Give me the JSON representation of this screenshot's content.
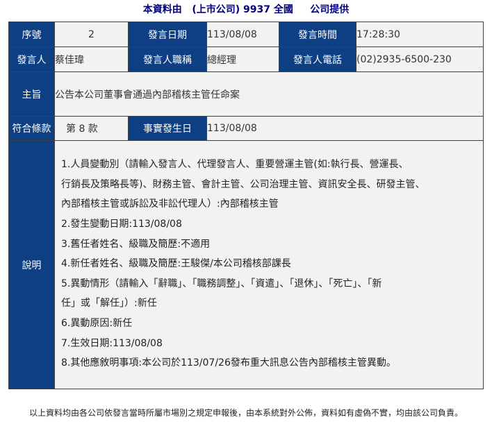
{
  "header": {
    "part1": "本資料由",
    "part2": "(上市公司) 9937 全國",
    "part3": "公司提供"
  },
  "table": {
    "labels": {
      "seq": "序號",
      "date": "發言日期",
      "time": "發言時間",
      "speaker": "發言人",
      "title": "發言人職稱",
      "phone": "發言人電話",
      "subject": "主旨",
      "clause": "符合條款",
      "fact_date": "事實發生日",
      "description": "說明"
    },
    "values": {
      "seq": "2",
      "date": "113/08/08",
      "time": "17:28:30",
      "speaker": "蔡佳瑋",
      "title": "總經理",
      "phone": "(02)2935-6500-230",
      "subject": "公告本公司董事會通過內部稽核主管任命案",
      "clause": "第 8 款",
      "fact_date": "113/08/08"
    },
    "description_lines": [
      "1.人員變動別（請輸入發言人、代理發言人、重要營運主管(如:執行長、營運長、",
      "行銷長及策略長等)、財務主管、會計主管、公司治理主管、資訊安全長、研發主管、",
      "內部稽核主管或訴訟及非訟代理人）:內部稽核主管",
      "2.發生變動日期:113/08/08",
      "3.舊任者姓名、級職及簡歷:不適用",
      "4.新任者姓名、級職及簡歷:王駿傑/本公司稽核部課長",
      "5.異動情形（請輸入「辭職」、「職務調整」、「資遣」、「退休」、「死亡」、「新",
      "任」或「解任」）:新任",
      "6.異動原因:新任",
      "7.生效日期:113/08/08",
      "8.其他應敘明事項:本公司於113/07/26發布重大訊息公告內部稽核主管異動。"
    ]
  },
  "footer": {
    "text": "以上資料均由各公司依發言當時所屬市場別之規定申報後，由本系統對外公佈，資料如有虛偽不實，均由該公司負責。"
  }
}
